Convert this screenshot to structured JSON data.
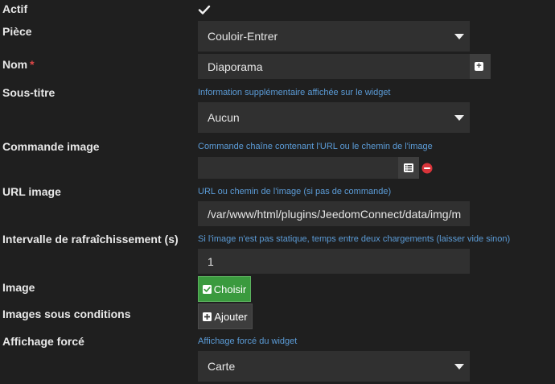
{
  "form": {
    "actif": {
      "label": "Actif"
    },
    "piece": {
      "label": "Pièce",
      "value": "Couloir-Entrer"
    },
    "nom": {
      "label": "Nom",
      "required_mark": "*",
      "value": "Diaporama"
    },
    "sous_titre": {
      "label": "Sous-titre",
      "help": "Information supplémentaire affichée sur le widget",
      "value": "Aucun"
    },
    "commande_image": {
      "label": "Commande image",
      "help": "Commande chaîne contenant l'URL ou le chemin de l'image",
      "value": ""
    },
    "url_image": {
      "label": "URL image",
      "help": "URL ou chemin de l'image (si pas de commande)",
      "value": "/var/www/html/plugins/JeedomConnect/data/img/m"
    },
    "intervalle": {
      "label": "Intervalle de rafraîchissement (s)",
      "help": "Si l'image n'est pas statique, temps entre deux chargements (laisser vide sinon)",
      "value": "1"
    },
    "image": {
      "label": "Image",
      "button_label": "Choisir"
    },
    "images_sous_conditions": {
      "label": "Images sous conditions",
      "button_label": "Ajouter"
    },
    "affichage_force": {
      "label": "Affichage forcé",
      "help": "Affichage forcé du widget",
      "value": "Carte"
    }
  },
  "icons": {
    "checkbox": "check-icon",
    "add": "plus-square-icon",
    "list": "list-icon",
    "remove": "minus-circle-icon",
    "select": "caret-down-icon"
  },
  "colors": {
    "background": "#1f1f1f",
    "field": "#303030",
    "help_text": "#5b9bd6",
    "required": "#e04848",
    "green_button": "#3a9a3e",
    "remove_icon": "#d9343a"
  }
}
